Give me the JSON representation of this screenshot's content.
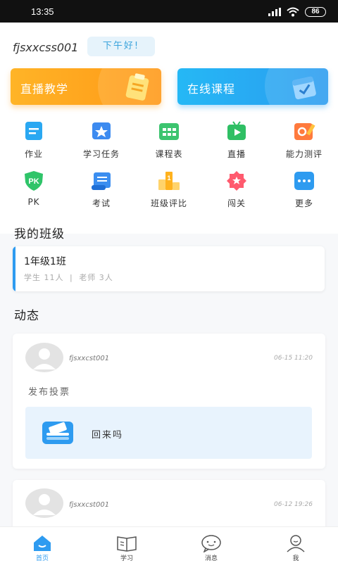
{
  "status_bar": {
    "time": "13:35",
    "battery": "86"
  },
  "header": {
    "username": "fjsxxcss001",
    "greeting": "下午好!"
  },
  "banners": {
    "live": "直播教学",
    "online": "在线课程"
  },
  "grid": {
    "homework": "作业",
    "tasks": "学习任务",
    "schedule": "课程表",
    "live": "直播",
    "assessment": "能力测评",
    "pk": "PK",
    "exam": "考试",
    "class_rank": "班级评比",
    "levels": "闯关",
    "more": "更多"
  },
  "my_class": {
    "title": "我的班级",
    "class_name": "1年级1班",
    "students": "学生 11人",
    "separator": "|",
    "teachers": "老师 3人"
  },
  "feed": {
    "title": "动态",
    "posts": [
      {
        "user": "fjsxxcst001",
        "time": "06-15 11:20",
        "text": "发布投票",
        "vote_title": "回来吗"
      },
      {
        "user": "fjsxxcst001",
        "time": "06-12 19:26"
      }
    ]
  },
  "tabs": {
    "home": "首页",
    "study": "学习",
    "messages": "消息",
    "me": "我"
  },
  "colors": {
    "accent": "#2e9bf0",
    "orange": "#ff9e1b"
  }
}
